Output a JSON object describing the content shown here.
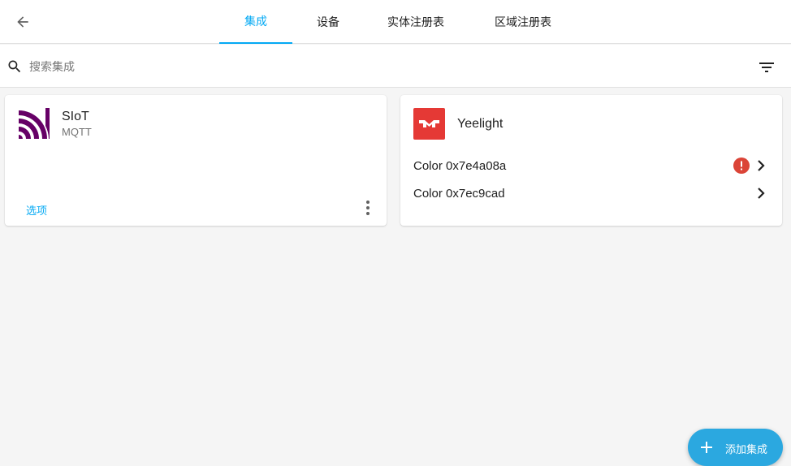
{
  "header": {
    "back_icon": "arrow-left-icon",
    "tabs": [
      {
        "label": "集成",
        "active": true
      },
      {
        "label": "设备",
        "active": false
      },
      {
        "label": "实体注册表",
        "active": false
      },
      {
        "label": "区域注册表",
        "active": false
      }
    ]
  },
  "search": {
    "placeholder": "搜索集成",
    "value": "",
    "icon": "search-icon",
    "filter_icon": "filter-icon"
  },
  "integrations": [
    {
      "title": "SIoT",
      "subtitle": "MQTT",
      "logo_icon": "mqtt-logo-icon",
      "logo_color": "#660066",
      "options_label": "选项",
      "menu_icon": "more-vertical-icon"
    },
    {
      "title": "Yeelight",
      "logo_icon": "yeelight-logo-icon",
      "logo_color": "#e53935",
      "devices": [
        {
          "name": "Color 0x7e4a08a",
          "has_error": true
        },
        {
          "name": "Color 0x7ec9cad",
          "has_error": false
        }
      ]
    }
  ],
  "fab": {
    "label": "添加集成",
    "icon": "plus-icon"
  },
  "colors": {
    "accent": "#03a9f4",
    "fab": "#2ba8e0",
    "error": "#db4437",
    "background": "#f5f5f5"
  }
}
